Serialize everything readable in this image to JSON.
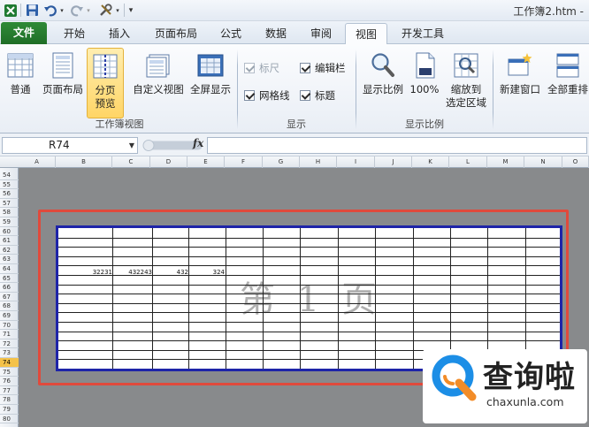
{
  "window": {
    "title": "工作簿2.htm -"
  },
  "tabs": [
    {
      "label": "文件",
      "kind": "file"
    },
    {
      "label": "开始"
    },
    {
      "label": "插入"
    },
    {
      "label": "页面布局"
    },
    {
      "label": "公式"
    },
    {
      "label": "数据"
    },
    {
      "label": "审阅"
    },
    {
      "label": "视图",
      "active": true
    },
    {
      "label": "开发工具"
    }
  ],
  "ribbon": {
    "workbook_views": {
      "group_label": "工作簿视图",
      "normal": "普通",
      "page_layout": "页面布局",
      "page_break_preview_l1": "分页",
      "page_break_preview_l2": "预览",
      "custom_views": "自定义视图",
      "full_screen": "全屏显示"
    },
    "show": {
      "group_label": "显示",
      "ruler": "标尺",
      "formula_bar": "编辑栏",
      "gridlines": "网格线",
      "headings": "标题"
    },
    "zoom": {
      "group_label": "显示比例",
      "zoom": "显示比例",
      "zoom_100": "100%",
      "zoom_selection_l1": "缩放到",
      "zoom_selection_l2": "选定区域"
    },
    "window": {
      "new_window": "新建窗口",
      "arrange_all": "全部重排"
    }
  },
  "formula_bar": {
    "name_box": "R74",
    "fx": "fx",
    "value": ""
  },
  "columns": [
    "A",
    "B",
    "C",
    "D",
    "E",
    "F",
    "G",
    "H",
    "I",
    "J",
    "K",
    "L",
    "M",
    "N",
    "O"
  ],
  "rows": [
    "54",
    "55",
    "56",
    "57",
    "58",
    "59",
    "60",
    "61",
    "62",
    "63",
    "64",
    "65",
    "66",
    "67",
    "68",
    "69",
    "70",
    "71",
    "72",
    "73",
    "74",
    "75",
    "76",
    "77",
    "78",
    "79",
    "80"
  ],
  "selected_row": "74",
  "cells": {
    "B64": "32231",
    "C64": "432243",
    "D64": "432",
    "E64": "324"
  },
  "page_watermark": "第 1 页",
  "logo": {
    "name": "查询啦",
    "url": "chaxunla.com"
  },
  "colors": {
    "file_tab": "#2f8a37",
    "page_border": "#1e24a8",
    "print_area": "#e04a3c",
    "active_button": "#ffd566",
    "background_gray": "#888a8c"
  }
}
